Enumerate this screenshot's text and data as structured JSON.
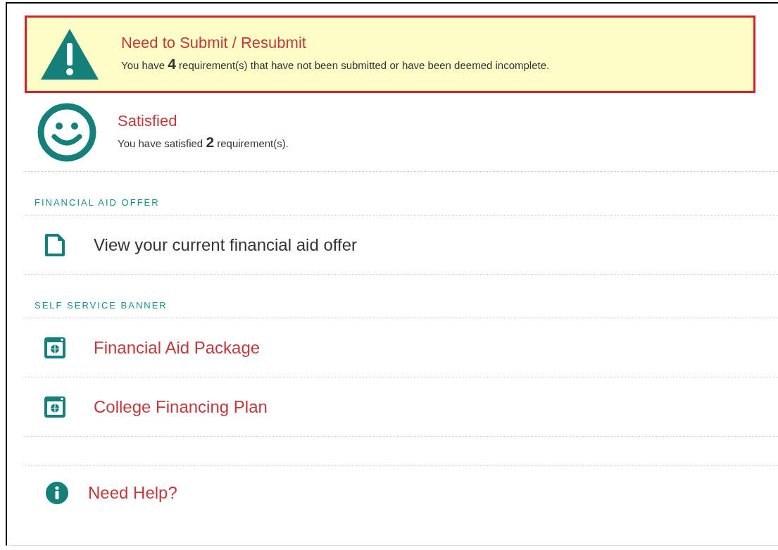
{
  "statuses": [
    {
      "kind": "warning",
      "title": "Need to Submit / Resubmit",
      "message": "You have **4** requirement(s) that have not been submitted or have been deemed incomplete.",
      "highlighted": true
    },
    {
      "kind": "ok",
      "title": "Satisfied",
      "message": "You have satisfied **2** requirement(s).",
      "highlighted": false
    }
  ],
  "sections": [
    {
      "heading": "FINANCIAL AID OFFER",
      "links": [
        {
          "kind": "document",
          "label": "View your current financial aid offer"
        }
      ]
    },
    {
      "heading": "SELF SERVICE BANNER",
      "links": [
        {
          "kind": "banner",
          "label": "Financial Aid Package"
        },
        {
          "kind": "banner",
          "label": "College Financing Plan"
        }
      ]
    }
  ],
  "help": {
    "label": "Need Help?"
  }
}
